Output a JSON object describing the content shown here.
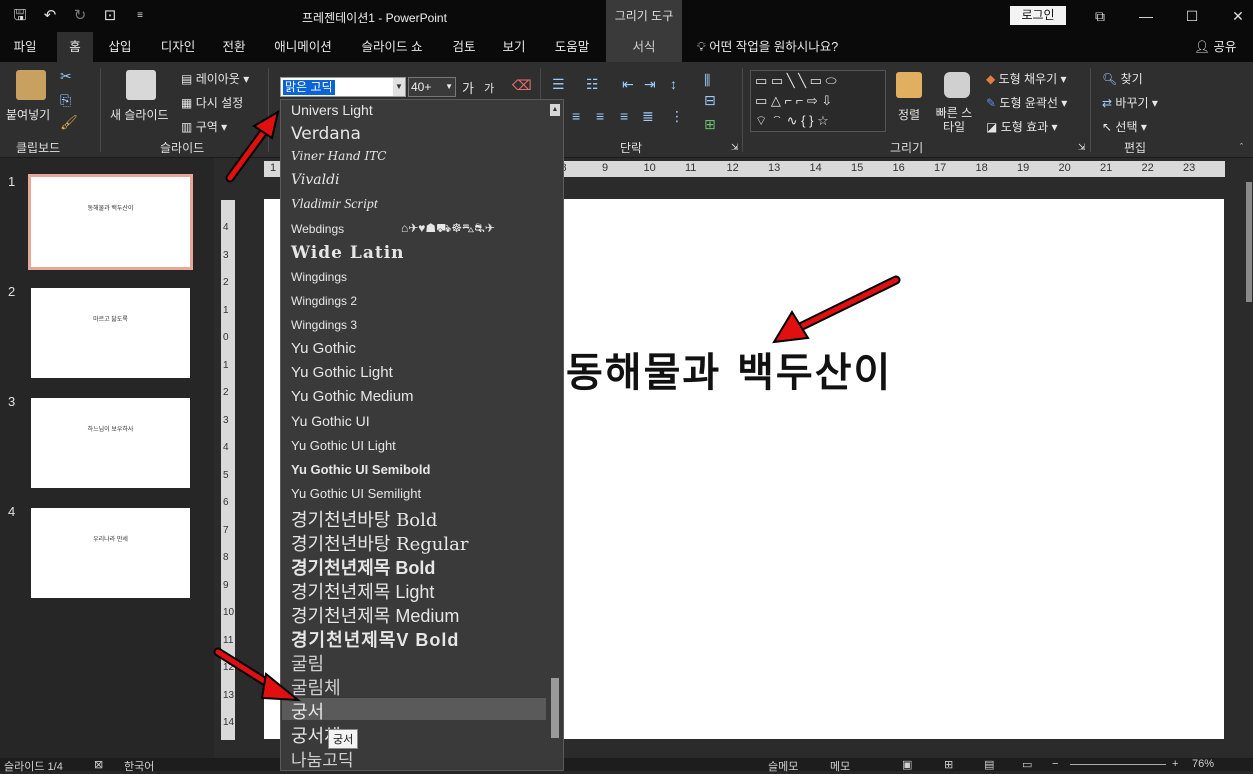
{
  "title_bar": {
    "document_title": "프레젠테이션1  -  PowerPoint",
    "context_group": "그리기 도구",
    "login_label": "로그인"
  },
  "tabs": [
    "파일",
    "홈",
    "삽입",
    "디자인",
    "전환",
    "애니메이션",
    "슬라이드 쇼",
    "검토",
    "보기",
    "도움말",
    "서식"
  ],
  "active_tab": "홈",
  "tell_me": "어떤 작업을 원하시나요?",
  "share": "공유",
  "ribbon": {
    "clipboard": {
      "paste": "붙여넣기",
      "group": "클립보드"
    },
    "slides": {
      "new_slide": "새 슬라이드",
      "layout": "레이아웃",
      "reset": "다시 설정",
      "section": "구역",
      "group": "슬라이드"
    },
    "font": {
      "name": "맑은 고딕",
      "size": "40+"
    },
    "paragraph": {
      "group": "단락"
    },
    "drawing": {
      "arrange": "정렬",
      "quick_styles": "빠른 스타일",
      "fill": "도형 채우기",
      "outline": "도형 윤곽선",
      "effects": "도형 효과",
      "group": "그리기"
    },
    "editing": {
      "find": "찾기",
      "replace": "바꾸기",
      "select": "선택",
      "group": "편집"
    }
  },
  "slides": [
    {
      "number": "1",
      "text": "동해물과 백두산이"
    },
    {
      "number": "2",
      "text": "마르고 닳도록"
    },
    {
      "number": "3",
      "text": "하느님이 보우하사"
    },
    {
      "number": "4",
      "text": "우리나라 만세"
    }
  ],
  "main_slide_text": "동해물과 백두산이",
  "font_list": [
    "Univers Light",
    "Verdana",
    "Viner Hand ITC",
    "Vivaldi",
    "Vladimir Script",
    "Webdings",
    "Wide Latin",
    "Wingdings",
    "Wingdings 2",
    "Wingdings 3",
    "Yu Gothic",
    "Yu Gothic Light",
    "Yu Gothic Medium",
    "Yu Gothic UI",
    "Yu Gothic UI Light",
    "Yu Gothic UI Semibold",
    "Yu Gothic UI Semilight",
    "경기천년바탕 Bold",
    "경기천년바탕 Regular",
    "경기천년제목 Bold",
    "경기천년제목 Light",
    "경기천년제목 Medium",
    "경기천년제목V Bold",
    "굴림",
    "굴림체",
    "궁서",
    "궁서체",
    "나눔고딕"
  ],
  "hovered_font": "궁서",
  "tooltip": "궁서",
  "ruler_h": [
    "1",
    "2",
    "3",
    "4",
    "5",
    "6",
    "7",
    "8",
    "9",
    "10",
    "11",
    "12",
    "13",
    "14",
    "15",
    "16",
    "17",
    "18",
    "19",
    "20",
    "21",
    "22",
    "23"
  ],
  "ruler_v": [
    "4",
    "3",
    "2",
    "1",
    "0",
    "1",
    "2",
    "3",
    "4",
    "5",
    "6",
    "7",
    "8",
    "9",
    "10",
    "11",
    "12",
    "13",
    "14"
  ],
  "status": {
    "slide": "슬라이드 1/4",
    "lang": "한국어",
    "notes": "슬메모",
    "comments": "메모",
    "zoom": "76%"
  }
}
